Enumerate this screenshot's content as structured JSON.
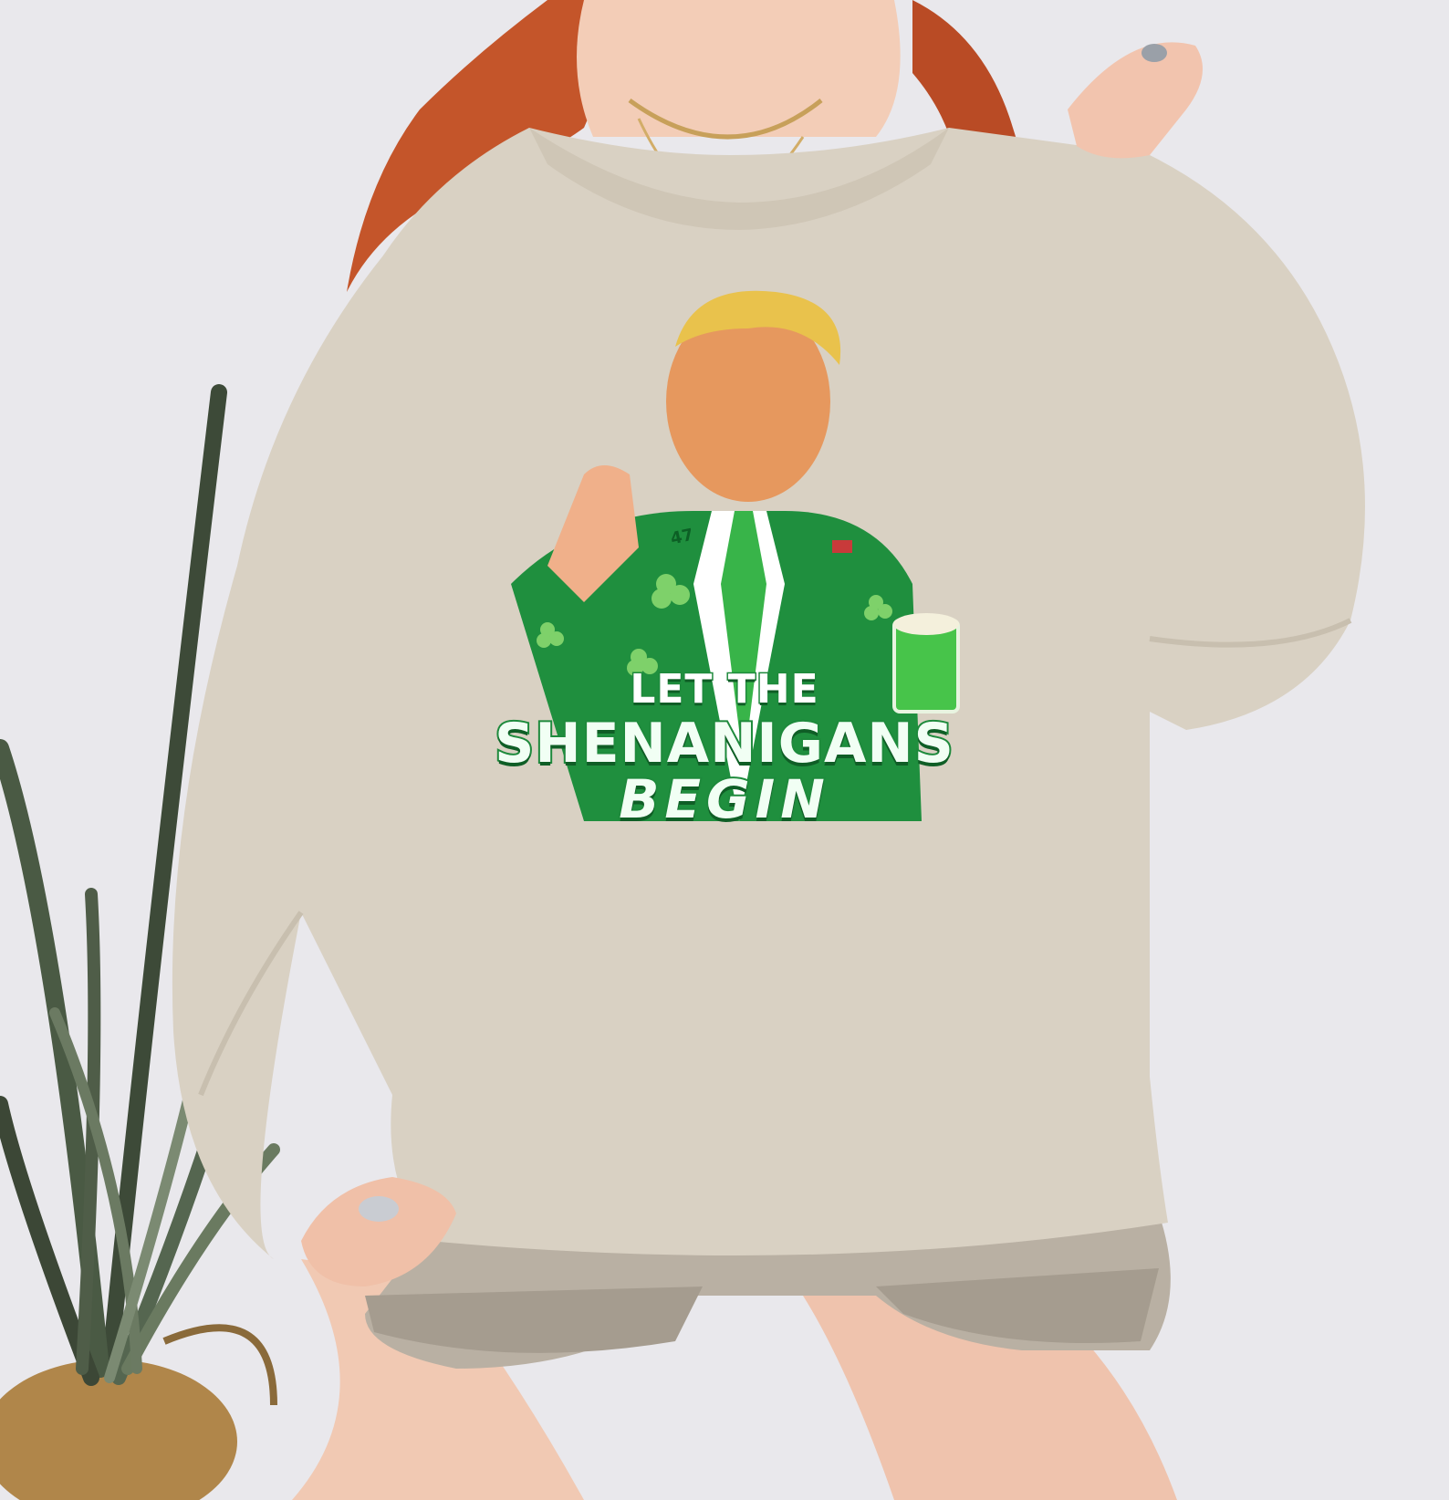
{
  "print": {
    "line1": "LET THE",
    "line2": "SHENANIGANS",
    "line3": "BEGIN",
    "lapel_number": "47"
  },
  "colors": {
    "wall": "#e9e8ec",
    "sweatshirt": "#d9d1c3",
    "hair": "#c4552a",
    "suit_green": "#1f8f3e",
    "text_outline": "#1e8a3c",
    "shorts": "#b9b0a3",
    "stool": "#c98a3f"
  },
  "icons": [
    "shamrock-icon",
    "flag-pin-icon",
    "plant-icon"
  ]
}
